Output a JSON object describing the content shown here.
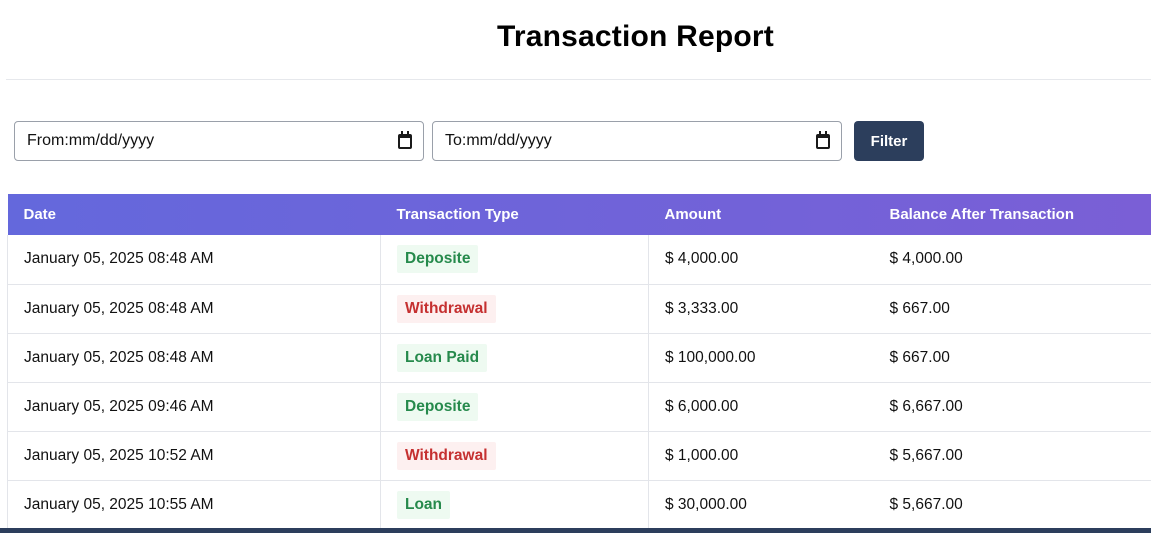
{
  "header": {
    "title": "Transaction Report"
  },
  "filters": {
    "from_prefix": "From:",
    "from_value": "mm/dd/yyyy",
    "to_prefix": "To:",
    "to_value": "mm/dd/yyyy",
    "calendar_icon": "calendar-icon",
    "filter_label": "Filter"
  },
  "table": {
    "columns": [
      "Date",
      "Transaction Type",
      "Amount",
      "Balance After Transaction"
    ],
    "rows": [
      {
        "date": "January 05, 2025 08:48 AM",
        "type": "Deposite",
        "type_color": "green",
        "amount": "$ 4,000.00",
        "balance": "$ 4,000.00"
      },
      {
        "date": "January 05, 2025 08:48 AM",
        "type": "Withdrawal",
        "type_color": "red",
        "amount": "$ 3,333.00",
        "balance": "$ 667.00"
      },
      {
        "date": "January 05, 2025 08:48 AM",
        "type": "Loan Paid",
        "type_color": "green",
        "amount": "$ 100,000.00",
        "balance": "$ 667.00"
      },
      {
        "date": "January 05, 2025 09:46 AM",
        "type": "Deposite",
        "type_color": "green",
        "amount": "$ 6,000.00",
        "balance": "$ 6,667.00"
      },
      {
        "date": "January 05, 2025 10:52 AM",
        "type": "Withdrawal",
        "type_color": "red",
        "amount": "$ 1,000.00",
        "balance": "$ 5,667.00"
      },
      {
        "date": "January 05, 2025 10:55 AM",
        "type": "Loan",
        "type_color": "green",
        "amount": "$ 30,000.00",
        "balance": "$ 5,667.00"
      }
    ]
  },
  "colors": {
    "header_gradient_start": "#6468dc",
    "header_gradient_end": "#7a5fd6",
    "button_bg": "#2c3e5c",
    "credit_text": "#268a4c",
    "debit_text": "#c53030"
  }
}
